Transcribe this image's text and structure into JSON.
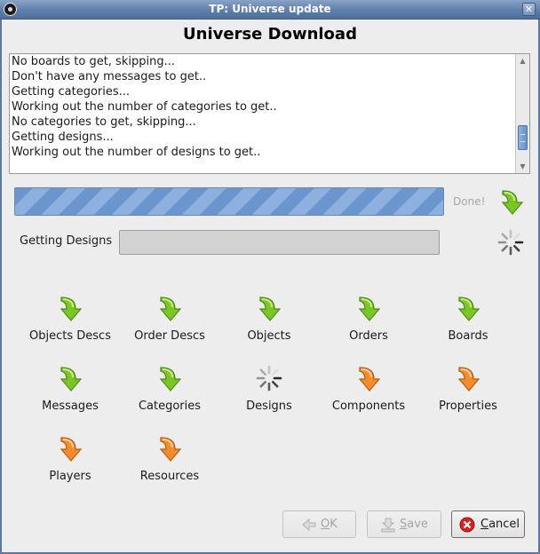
{
  "window": {
    "title": "TP: Universe update",
    "close_symbol": "✕",
    "icon": "thousand-parsec-icon"
  },
  "heading": "Universe Download",
  "log": {
    "lines": [
      "No boards to get, skipping...",
      "Don't have any messages to get..",
      "Getting categories...",
      "Working out the number of categories to get..",
      "No categories to get, skipping...",
      "Getting designs...",
      "Working out the number of designs to get.."
    ],
    "scroll_position": 0.84
  },
  "overall": {
    "progress": 1.0,
    "status_label": "Done!",
    "icon": "green-down-arrow-icon"
  },
  "current": {
    "label": "Getting Designs",
    "progress": 0.0,
    "icon": "loading-spinner-icon"
  },
  "steps": [
    {
      "label": "Objects Descs",
      "state": "done",
      "icon": "green-down-arrow-icon"
    },
    {
      "label": "Order Descs",
      "state": "done",
      "icon": "green-down-arrow-icon"
    },
    {
      "label": "Objects",
      "state": "done",
      "icon": "green-down-arrow-icon"
    },
    {
      "label": "Orders",
      "state": "done",
      "icon": "green-down-arrow-icon"
    },
    {
      "label": "Boards",
      "state": "done",
      "icon": "green-down-arrow-icon"
    },
    {
      "label": "Messages",
      "state": "done",
      "icon": "green-down-arrow-icon"
    },
    {
      "label": "Categories",
      "state": "done",
      "icon": "green-down-arrow-icon"
    },
    {
      "label": "Designs",
      "state": "loading",
      "icon": "loading-spinner-icon"
    },
    {
      "label": "Components",
      "state": "pending",
      "icon": "orange-down-arrow-icon"
    },
    {
      "label": "Properties",
      "state": "pending",
      "icon": "orange-down-arrow-icon"
    },
    {
      "label": "Players",
      "state": "pending",
      "icon": "orange-down-arrow-icon"
    },
    {
      "label": "Resources",
      "state": "pending",
      "icon": "orange-down-arrow-icon"
    }
  ],
  "buttons": {
    "ok": {
      "label": "OK",
      "mnemonic": "O",
      "rest": "K",
      "enabled": false,
      "icon": "ok-arrow-icon"
    },
    "save": {
      "label": "Save",
      "mnemonic": "S",
      "rest": "ave",
      "enabled": false,
      "icon": "save-download-icon"
    },
    "cancel": {
      "label": "Cancel",
      "mnemonic": "C",
      "rest": "ancel",
      "enabled": true,
      "icon": "cancel-circle-icon"
    }
  },
  "colors": {
    "done_green": "#7cc526",
    "pending_orange": "#f28d2e",
    "progress_blue": "#6b95cd",
    "cancel_red": "#d62222"
  }
}
